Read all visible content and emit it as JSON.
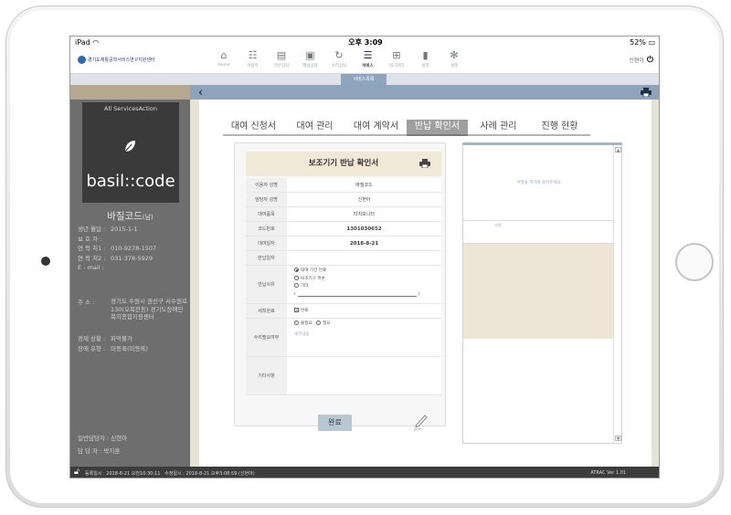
{
  "statusbar": {
    "device": "iPad",
    "wifi_icon": "wifi-icon",
    "time": "오후 3:09",
    "battery": "52%"
  },
  "header": {
    "logo_small": "Gyeonggi Do",
    "logo": "경기도재활공학서비스연구지원센터",
    "nav": [
      {
        "label": "Home",
        "icon": "home-icon"
      },
      {
        "label": "이용자",
        "icon": "users-icon"
      },
      {
        "label": "전문상담",
        "icon": "consult-doc-icon"
      },
      {
        "label": "재방상담",
        "icon": "revisit-doc-icon"
      },
      {
        "label": "수리상담",
        "icon": "repair-icon"
      },
      {
        "label": "서비스",
        "icon": "list-icon"
      },
      {
        "label": "대기관리",
        "icon": "cart-icon"
      },
      {
        "label": "실적",
        "icon": "bar-chart-icon"
      },
      {
        "label": "설정",
        "icon": "gear-icon"
      }
    ],
    "user": "신현아"
  },
  "subnav": {
    "active": "서비스목록"
  },
  "sidebar": {
    "brand_top": "All ServicesAction",
    "brand_name": "basil::code",
    "person_name": "바질코드",
    "person_suffix": "(남)",
    "info": [
      {
        "k": "생년 월일 :",
        "v": "2015-1-1"
      },
      {
        "k": "보 호 자 :",
        "v": ""
      },
      {
        "k": "연 락 처1 :",
        "v": "010-9278-1507"
      },
      {
        "k": "연 락 처2 :",
        "v": "031-378-5929"
      },
      {
        "k": "E - mail :",
        "v": ""
      }
    ],
    "address_key": "주 소 :",
    "address": "경기도 수원시 권선구 서수원로 130(오목천동) 경기도장애인복지종합지원센터",
    "extra": [
      {
        "k": "경제 상황 :",
        "v": "파악불가"
      },
      {
        "k": "장애 유형 :",
        "v": "미등록(미등록)"
      }
    ],
    "bottom": [
      {
        "k": "일반담당자 :",
        "v": "신현아"
      },
      {
        "k": "담 당 자 :",
        "v": "박지훈"
      }
    ]
  },
  "tabs": [
    "대여 신청서",
    "대여 관리",
    "대여 계약서",
    "반납 확인서",
    "사례 관리",
    "진행 현황"
  ],
  "form": {
    "title": "보조기기 반납 확인서",
    "rows": [
      {
        "label": "이용자 성명",
        "value": "바질코드"
      },
      {
        "label": "담당자 성명",
        "value": "신현아"
      },
      {
        "label": "대여품목",
        "value": "터치모니터"
      },
      {
        "label": "코드번호",
        "value": "1301030652"
      },
      {
        "label": "대여일자",
        "value": "2018-8-21"
      },
      {
        "label": "반납일자",
        "value": ""
      }
    ],
    "reason_label": "반납사유",
    "reasons": [
      "대여 기간 만료",
      "보조기구 파손",
      "기타"
    ],
    "clean_label": "세척완료",
    "clean_value": "완료",
    "repair_label": "수리필요여부",
    "repair_options": [
      "불필요",
      "필요"
    ],
    "repair_placeholder": "세부내용",
    "etc_label": "기타사항",
    "done_button": "완료"
  },
  "signature": {
    "placeholder": "서명을 여기에 올려주세요",
    "caption": "서명"
  },
  "footer": {
    "registered": "등록일시 : 2018-8-21 오전10:30:11",
    "modified": "수정일시 : 2018-8-21 오후3:08:59 (신현아)",
    "version": "ATRAC Ver 1.01"
  },
  "colors": {
    "nav_active": "#1e2f4a",
    "toolbar": "#8fa4bc",
    "sidebar": "#6e6e6e",
    "beige": "#e8e1d6"
  }
}
